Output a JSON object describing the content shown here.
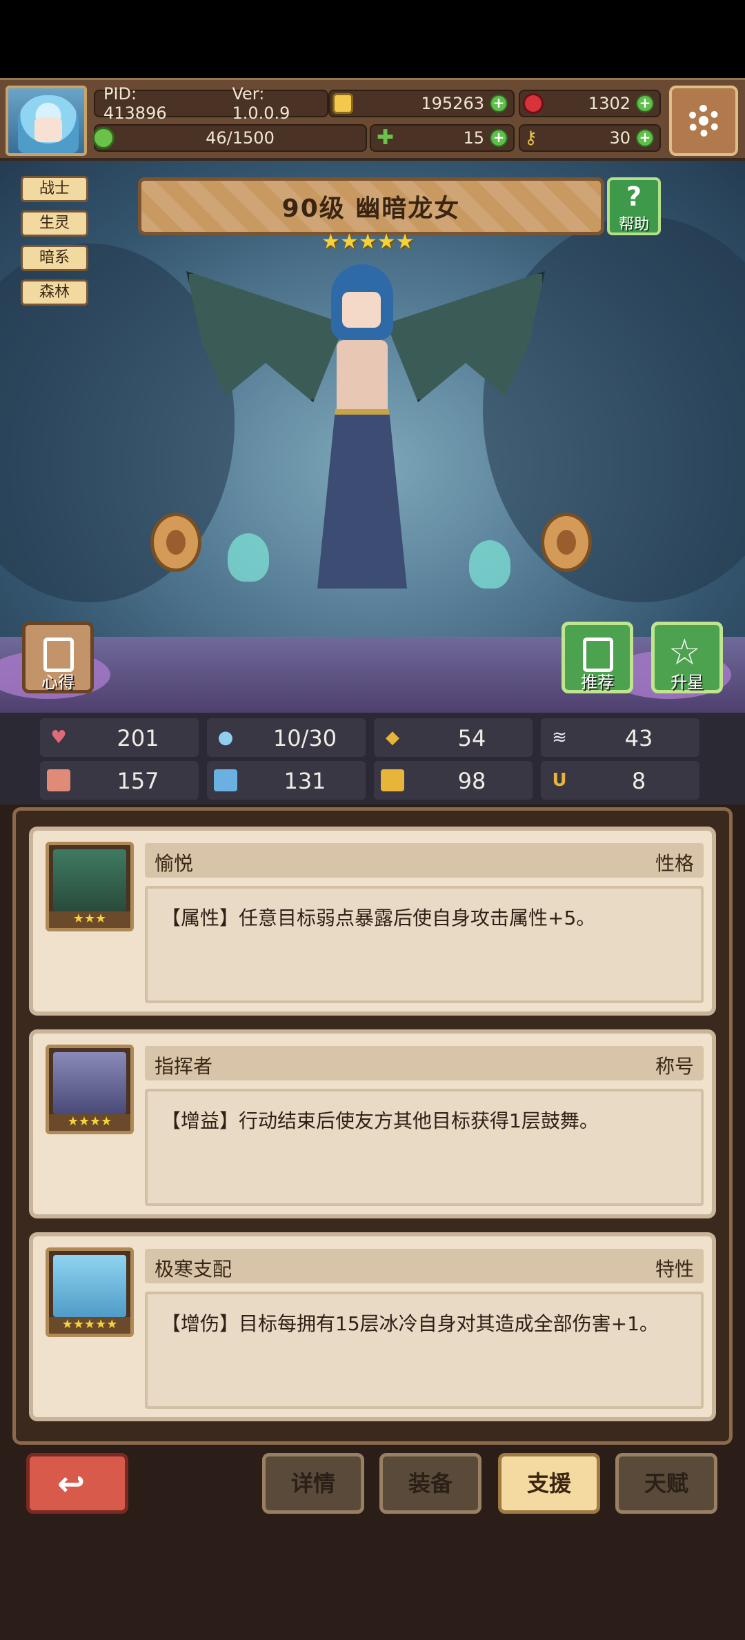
{
  "header": {
    "pid": "PID: 413896",
    "version": "Ver: 1.0.0.9",
    "gold": "195263",
    "gems": "1302",
    "stamina": "46/1500",
    "clover": "15",
    "key": "30"
  },
  "hero": {
    "tags": [
      "战士",
      "生灵",
      "暗系",
      "森林"
    ],
    "title": "90级  幽暗龙女",
    "stars": "★★★★★",
    "help_label": "帮助",
    "buttons": {
      "insight": "心得",
      "recommend": "推荐",
      "upgrade": "升星"
    }
  },
  "stats": [
    {
      "icon": "heart-icon",
      "value": "201"
    },
    {
      "icon": "water-drop-icon",
      "value": "10/30"
    },
    {
      "icon": "shield-icon",
      "value": "54"
    },
    {
      "icon": "wing-icon",
      "value": "43"
    },
    {
      "icon": "fist-icon",
      "value": "157"
    },
    {
      "icon": "book-icon",
      "value": "131"
    },
    {
      "icon": "boot-icon",
      "value": "98"
    },
    {
      "icon": "horseshoe-icon",
      "value": "8"
    }
  ],
  "traits": [
    {
      "name": "愉悦",
      "type": "性格",
      "desc": "【属性】任意目标弱点暴露后使自身攻击属性+5。",
      "stars": "★★★"
    },
    {
      "name": "指挥者",
      "type": "称号",
      "desc": "【增益】行动结束后使友方其他目标获得1层鼓舞。",
      "stars": "★★★★"
    },
    {
      "name": "极寒支配",
      "type": "特性",
      "desc": "【增伤】目标每拥有15层冰冷自身对其造成全部伤害+1。",
      "stars": "★★★★★"
    }
  ],
  "tabs": {
    "details": "详情",
    "equipment": "装备",
    "support": "支援",
    "talent": "天赋"
  },
  "colors": {
    "accent_green": "#5fbf4a",
    "back_red": "#d85a4a",
    "active_tab": "#f4d9a0"
  }
}
